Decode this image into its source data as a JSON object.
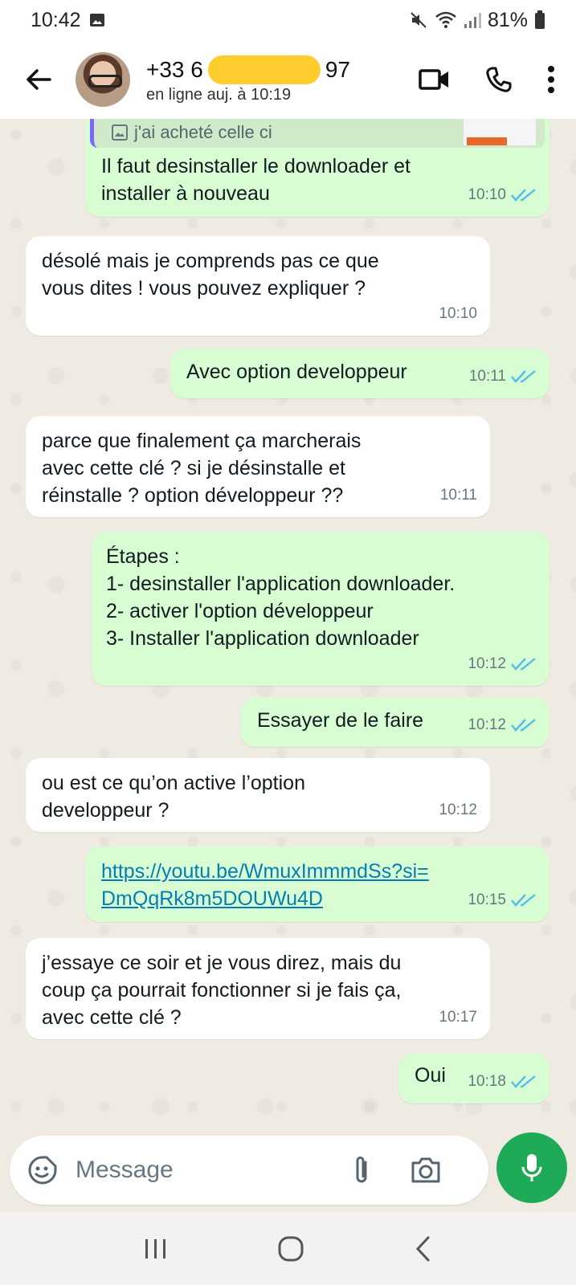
{
  "status_bar": {
    "time": "10:42",
    "battery": "81%"
  },
  "header": {
    "contact_prefix": "+33 6",
    "contact_suffix": "97",
    "status": "en ligne auj. à 10:19"
  },
  "quote": {
    "text": "j'ai acheté celle ci"
  },
  "messages": [
    {
      "direction": "out",
      "text": "Il faut desinstaller le downloader et\ninstaller à nouveau",
      "time": "10:10",
      "read": true
    },
    {
      "direction": "in",
      "text": "désolé mais je comprends pas ce que\nvous dites ! vous pouvez expliquer ?",
      "time": "10:10"
    },
    {
      "direction": "out",
      "text": "Avec option developpeur",
      "time": "10:11",
      "read": true
    },
    {
      "direction": "in",
      "text": "parce que finalement ça marcherais\navec cette clé ? si je désinstalle et\nréinstalle ? option développeur ??",
      "time": "10:11"
    },
    {
      "direction": "out",
      "text": "Étapes :\n1- desinstaller l'application downloader.\n2- activer l'option développeur\n3- Installer l'application downloader",
      "time": "10:12",
      "read": true
    },
    {
      "direction": "out",
      "text": "Essayer de le faire",
      "time": "10:12",
      "read": true
    },
    {
      "direction": "in",
      "text": "ou est ce qu’on active l’option\ndeveloppeur ?",
      "time": "10:12"
    },
    {
      "direction": "out",
      "text": "https://youtu.be/WmuxImmmdSs?si=\nDmQqRk8m5DOUWu4D",
      "time": "10:15",
      "read": true
    },
    {
      "direction": "in",
      "text": "j’essaye ce soir et je vous direz, mais du\ncoup ça pourrait fonctionner si je fais ça,\navec cette clé ?",
      "time": "10:17"
    },
    {
      "direction": "out",
      "text": "Oui",
      "time": "10:18",
      "read": true
    }
  ],
  "input": {
    "placeholder": "Message"
  },
  "colors": {
    "outgoing_bubble": "#d9fdd3",
    "incoming_bubble": "#ffffff",
    "read_ticks": "#53bdeb",
    "mic_button": "#1faa58",
    "quote_bar": "#7f66ff"
  },
  "icons": {
    "header": [
      "back-arrow-icon",
      "video-call-icon",
      "phone-icon",
      "more-vert-icon"
    ],
    "input": [
      "sticker-icon",
      "attach-icon",
      "camera-icon",
      "mic-icon"
    ],
    "nav": [
      "recents-icon",
      "home-icon",
      "back-icon"
    ]
  }
}
